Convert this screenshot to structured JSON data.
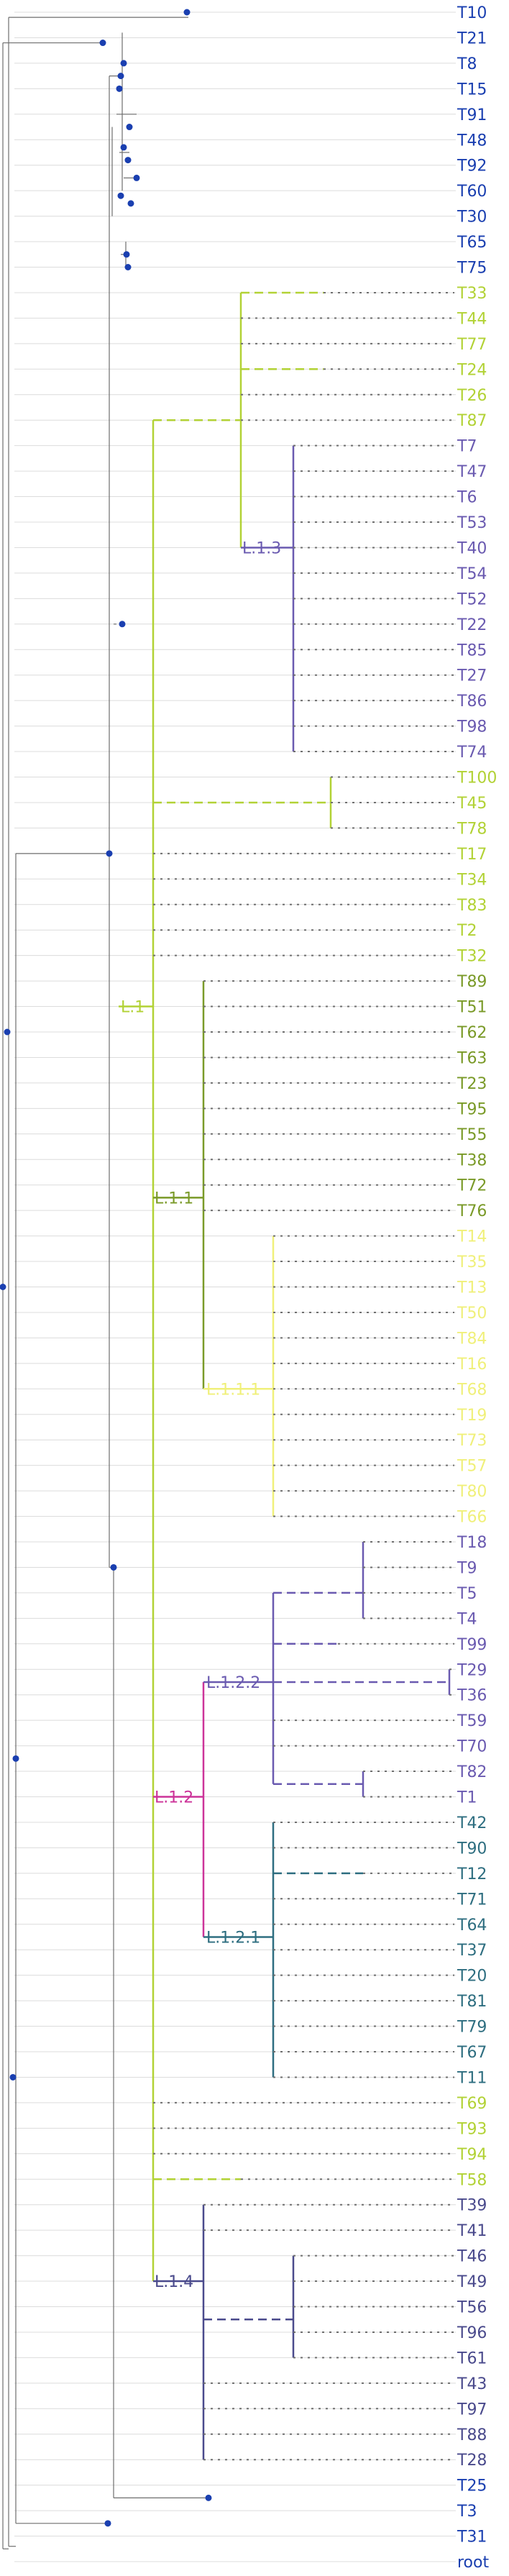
{
  "colors": {
    "root_blue": "#1a3fb0",
    "L1": "#b2d235",
    "L1_3": "#6a5ab0",
    "L1_1": "#7a9a28",
    "L1_1_1": "#f0f07a",
    "L1_2": "#cc3399",
    "L1_2_2": "#6a5ab0",
    "L1_2_1": "#2e6e80",
    "L1_4": "#4a4a8c",
    "grey": "#6e6e6e"
  },
  "clade_labels": {
    "L1": "L.1",
    "L1_1": "L.1.1",
    "L1_1_1": "L.1.1.1",
    "L1_2": "L.1.2",
    "L1_2_1": "L.1.2.1",
    "L1_2_2": "L.1.2.2",
    "L1_3": "L.1.3",
    "L1_4": "L.1.4"
  },
  "tips": [
    "T10",
    "T21",
    "T8",
    "T15",
    "T91",
    "T48",
    "T92",
    "T60",
    "T30",
    "T65",
    "T75",
    "T33",
    "T44",
    "T77",
    "T24",
    "T26",
    "T87",
    "T7",
    "T47",
    "T6",
    "T53",
    "T40",
    "T54",
    "T52",
    "T22",
    "T85",
    "T27",
    "T86",
    "T98",
    "T74",
    "T100",
    "T45",
    "T78",
    "T17",
    "T34",
    "T83",
    "T2",
    "T32",
    "T89",
    "T51",
    "T62",
    "T63",
    "T23",
    "T95",
    "T55",
    "T38",
    "T72",
    "T76",
    "T14",
    "T35",
    "T13",
    "T50",
    "T84",
    "T16",
    "T68",
    "T19",
    "T73",
    "T57",
    "T80",
    "T66",
    "T18",
    "T9",
    "T5",
    "T4",
    "T99",
    "T29",
    "T36",
    "T59",
    "T70",
    "T82",
    "T1",
    "T42",
    "T90",
    "T12",
    "T71",
    "T64",
    "T37",
    "T20",
    "T81",
    "T79",
    "T67",
    "T11",
    "T69",
    "T93",
    "T94",
    "T58",
    "T39",
    "T41",
    "T46",
    "T49",
    "T56",
    "T96",
    "T61",
    "T43",
    "T97",
    "T88",
    "T28",
    "T25",
    "T3",
    "T31",
    "root"
  ],
  "tip_groups": [
    {
      "from": 0,
      "to": 10,
      "color": "root_blue"
    },
    {
      "from": 11,
      "to": 16,
      "color": "L1"
    },
    {
      "from": 17,
      "to": 29,
      "color": "L1_3"
    },
    {
      "from": 30,
      "to": 37,
      "color": "L1"
    },
    {
      "from": 38,
      "to": 47,
      "color": "L1_1"
    },
    {
      "from": 48,
      "to": 59,
      "color": "L1_1_1"
    },
    {
      "from": 60,
      "to": 70,
      "color": "L1_2_2"
    },
    {
      "from": 71,
      "to": 81,
      "color": "L1_2_1"
    },
    {
      "from": 82,
      "to": 85,
      "color": "L1"
    },
    {
      "from": 86,
      "to": 96,
      "color": "L1_4"
    },
    {
      "from": 97,
      "to": 100,
      "color": "root_blue"
    }
  ]
}
